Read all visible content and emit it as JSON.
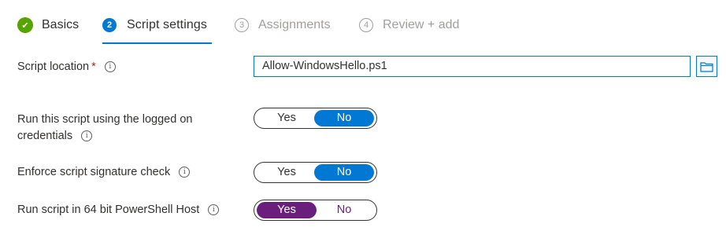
{
  "tabs": [
    {
      "label": "Basics",
      "number": "✔",
      "state": "done"
    },
    {
      "label": "Script settings",
      "number": "2",
      "state": "active"
    },
    {
      "label": "Assignments",
      "number": "3",
      "state": "disabled"
    },
    {
      "label": "Review + add",
      "number": "4",
      "state": "disabled"
    }
  ],
  "colors": {
    "accent": "#0078d4",
    "success": "#57a300",
    "required": "#a4262c",
    "selected_purple": "#6b1f7c",
    "disabled": "#a19f9d"
  },
  "form": {
    "script_location": {
      "label": "Script location",
      "required_mark": "*",
      "info_icon": "i",
      "value": "Allow-WindowsHello.ps1",
      "browse_icon": "folder-icon"
    },
    "logged_on_credentials": {
      "label": "Run this script using the logged on credentials",
      "info_icon": "i",
      "yes_label": "Yes",
      "no_label": "No",
      "selected": "No"
    },
    "signature_check": {
      "label": "Enforce script signature check",
      "info_icon": "i",
      "yes_label": "Yes",
      "no_label": "No",
      "selected": "No"
    },
    "powershell_64bit": {
      "label": "Run script in 64 bit PowerShell Host",
      "info_icon": "i",
      "yes_label": "Yes",
      "no_label": "No",
      "selected": "Yes"
    }
  }
}
